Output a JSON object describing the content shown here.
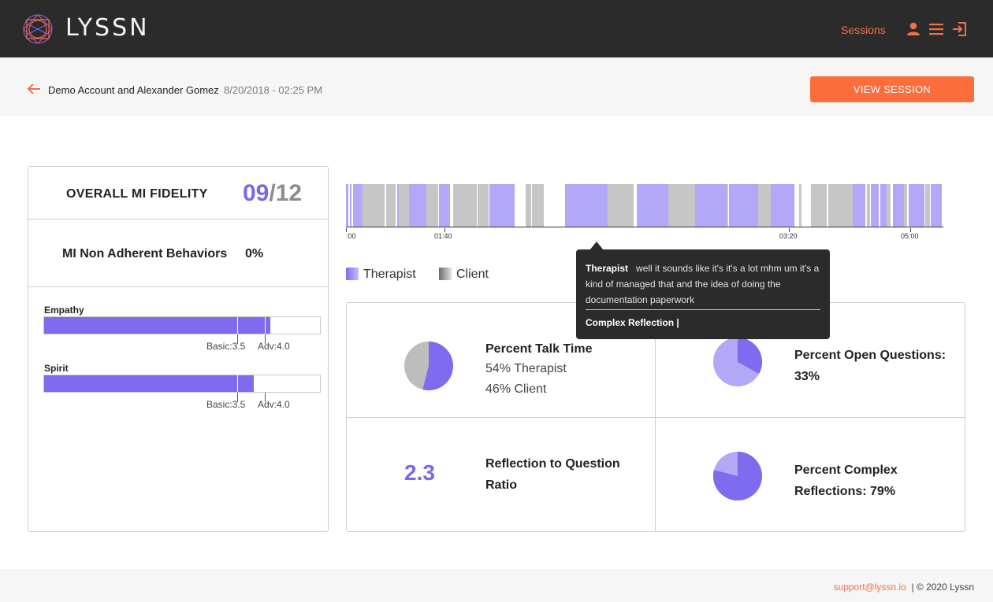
{
  "app": {
    "logo_text": "LYSSN"
  },
  "nav": {
    "sessions_label": "Sessions",
    "icons": [
      "user-icon",
      "menu-icon",
      "logout-icon"
    ]
  },
  "session": {
    "name": "Demo Account and Alexander Gomez",
    "date": "8/20/2018 - 02:25 PM",
    "view_button": "VIEW SESSION"
  },
  "fidelity": {
    "label": "OVERALL MI FIDELITY",
    "score": "09",
    "max": "/12",
    "non_adherent_label": "MI Non Adherent Behaviors",
    "non_adherent_value": "0%"
  },
  "metrics": [
    {
      "label": "Empathy",
      "value": 4.1,
      "basic_label": "Basic:3.5",
      "adv_label": "Adv:4.0"
    },
    {
      "label": "Spirit",
      "value": 3.8,
      "basic_label": "Basic:3.5",
      "adv_label": "Adv:4.0"
    }
  ],
  "timeline": {
    "axis_labels": [
      ":00",
      "01:40",
      "03:20",
      "05:00"
    ],
    "legend": {
      "therapist": "Therapist",
      "client": "Client"
    }
  },
  "tooltip": {
    "speaker": "Therapist",
    "text": "well it sounds like it's it's a lot mhm um it's a kind of managed that and the idea of doing the documentation paperwork",
    "code": "Complex Reflection |"
  },
  "stats": {
    "talk_time": {
      "title": "Percent Talk Time",
      "therapist": "54% Therapist",
      "client": "46% Client",
      "therapist_pct": 54
    },
    "open_questions": {
      "title": "Percent Open Questions:",
      "value": "33%",
      "pct": 33
    },
    "ratio": {
      "value": "2.3",
      "title_line1": "Reflection to Question",
      "title_line2": "Ratio"
    },
    "complex_reflections": {
      "title_line1": "Percent Complex",
      "title_line2": "Reflections: 79%",
      "pct": 79
    }
  },
  "colors": {
    "accent": "#fb6e3c",
    "therapist": "#b3a7f7",
    "purple": "#7e6bef",
    "client": "#c6c6c6"
  },
  "footer": {
    "email": "support@lyssn.io",
    "copyright": "|  © 2020 Lyssn"
  }
}
